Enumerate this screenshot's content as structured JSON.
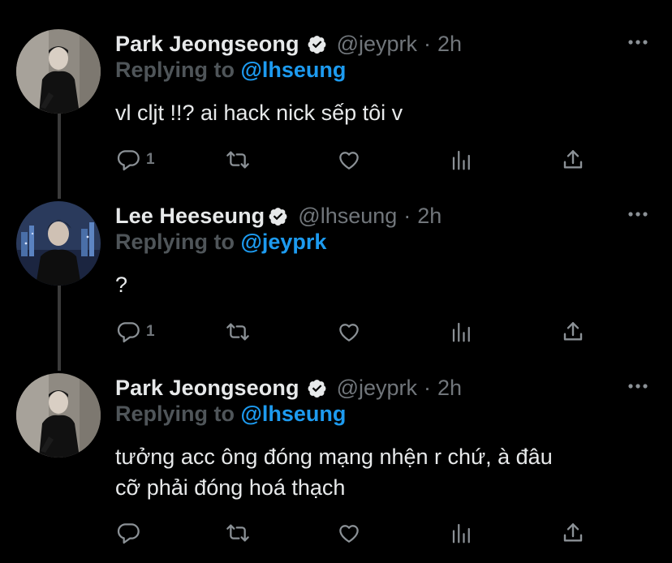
{
  "tweets": [
    {
      "display_name": "Park Jeongseong",
      "handle": "@jeyprk",
      "separator": "·",
      "time": "2h",
      "reply_prefix": "Replying to",
      "reply_to": "@lhseung",
      "text_lines": [
        "vl cljt !!? ai hack nick sếp tôi v"
      ],
      "reply_count": "1",
      "avatar": "person-in-black-avatar"
    },
    {
      "display_name": "Lee Heeseung",
      "handle": "@lhseung",
      "separator": "·",
      "time": "2h",
      "reply_prefix": "Replying to",
      "reply_to": "@jeyprk",
      "text_lines": [
        "?"
      ],
      "reply_count": "1",
      "avatar": "person-in-black-city-background-avatar"
    },
    {
      "display_name": "Park Jeongseong",
      "handle": "@jeyprk",
      "separator": "·",
      "time": "2h",
      "reply_prefix": "Replying to",
      "reply_to": "@lhseung",
      "text_lines": [
        "tưởng acc ông đóng mạng nhện r chứ, à đâu",
        "cỡ phải đóng hoá thạch"
      ],
      "reply_count": "",
      "avatar": "person-in-black-avatar"
    }
  ],
  "icons": {
    "reply": "reply-bubble-icon",
    "retweet": "retweet-icon",
    "like": "heart-icon",
    "views": "analytics-bars-icon",
    "share": "share-upload-icon",
    "verified": "verified-badge-icon",
    "more": "more-dots-icon"
  },
  "colors": {
    "background": "#000000",
    "primary_text": "#e7e9ea",
    "secondary_text": "#71767b",
    "link": "#1d9bf0",
    "thread_line": "#3b3b3b"
  }
}
